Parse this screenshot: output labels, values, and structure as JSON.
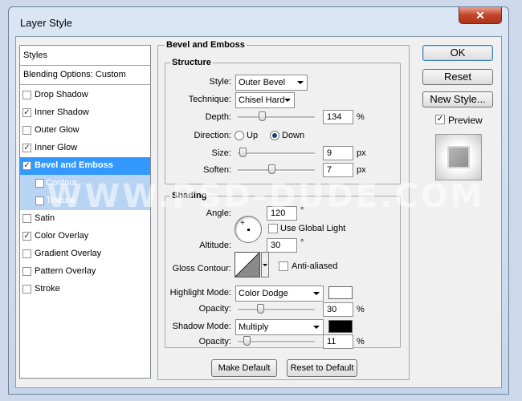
{
  "window": {
    "title": "Layer Style",
    "close_glyph": "✕"
  },
  "styles_list": {
    "header": "Styles",
    "blending_options": "Blending Options: Custom",
    "items": [
      {
        "label": "Drop Shadow",
        "checked": false
      },
      {
        "label": "Inner Shadow",
        "checked": true
      },
      {
        "label": "Outer Glow",
        "checked": false
      },
      {
        "label": "Inner Glow",
        "checked": true
      },
      {
        "label": "Bevel and Emboss",
        "checked": true,
        "selected": true
      },
      {
        "label": "Contour",
        "checked": false,
        "sub": true
      },
      {
        "label": "Texture",
        "checked": false,
        "sub": true
      },
      {
        "label": "Satin",
        "checked": false
      },
      {
        "label": "Color Overlay",
        "checked": true
      },
      {
        "label": "Gradient Overlay",
        "checked": false
      },
      {
        "label": "Pattern Overlay",
        "checked": false
      },
      {
        "label": "Stroke",
        "checked": false
      }
    ]
  },
  "bevel": {
    "section_title": "Bevel and Emboss",
    "structure": {
      "title": "Structure",
      "style_label": "Style:",
      "style_value": "Outer Bevel",
      "technique_label": "Technique:",
      "technique_value": "Chisel Hard",
      "depth_label": "Depth:",
      "depth_value": "134",
      "depth_unit": "%",
      "direction_label": "Direction:",
      "direction_up": "Up",
      "direction_down": "Down",
      "direction_selected": "Down",
      "size_label": "Size:",
      "size_value": "9",
      "size_unit": "px",
      "soften_label": "Soften:",
      "soften_value": "7",
      "soften_unit": "px"
    },
    "shading": {
      "title": "Shading",
      "angle_label": "Angle:",
      "angle_value": "120",
      "angle_unit": "°",
      "global_light_label": "Use Global Light",
      "global_light_checked": false,
      "altitude_label": "Altitude:",
      "altitude_value": "30",
      "altitude_unit": "°",
      "gloss_label": "Gloss Contour:",
      "anti_aliased_label": "Anti-aliased",
      "anti_aliased_checked": false,
      "highlight_mode_label": "Highlight Mode:",
      "highlight_mode_value": "Color Dodge",
      "highlight_color": "#ffffff",
      "highlight_opacity_label": "Opacity:",
      "highlight_opacity_value": "30",
      "highlight_opacity_unit": "%",
      "shadow_mode_label": "Shadow Mode:",
      "shadow_mode_value": "Multiply",
      "shadow_color": "#000000",
      "shadow_opacity_label": "Opacity:",
      "shadow_opacity_value": "11",
      "shadow_opacity_unit": "%"
    },
    "make_default": "Make Default",
    "reset_default": "Reset to Default"
  },
  "buttons": {
    "ok": "OK",
    "reset": "Reset",
    "new_style": "New Style...",
    "preview_label": "Preview",
    "preview_checked": true
  },
  "watermark": "WWW.PSD-DUDE.COM",
  "colors": {
    "selection": "#3399ff",
    "selection_sub": "#b7d4f3"
  }
}
